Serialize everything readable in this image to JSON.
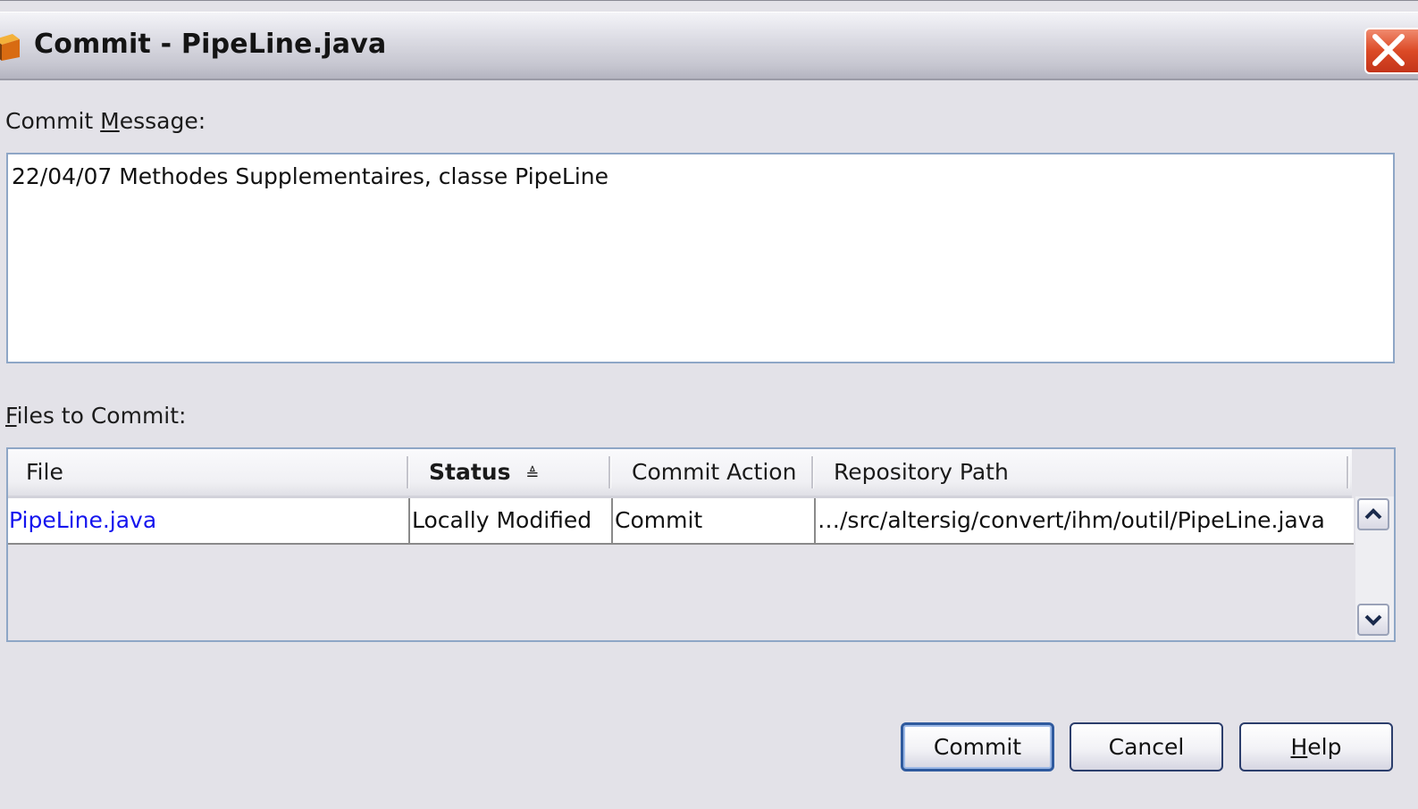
{
  "window": {
    "title": "Commit - PipeLine.java"
  },
  "message": {
    "label_prefix": "Commit ",
    "label_mnemonic": "M",
    "label_suffix": "essage:",
    "value": "22/04/07 Methodes Supplementaires, classe PipeLine"
  },
  "files": {
    "label_mnemonic": "F",
    "label_suffix": "iles to Commit:",
    "columns": [
      "File",
      "Status",
      "Commit Action",
      "Repository Path"
    ],
    "sort_indicator": "≜",
    "rows": [
      {
        "file": "PipeLine.java",
        "status": "Locally Modified",
        "action": "Commit",
        "path": "…/src/altersig/convert/ihm/outil/PipeLine.java"
      }
    ]
  },
  "buttons": {
    "commit": "Commit",
    "cancel": "Cancel",
    "help_mnemonic": "H",
    "help_suffix": "elp"
  },
  "colors": {
    "link": "#1515ee",
    "close": "#dc4a26",
    "border": "#8ea6c6"
  },
  "icons": {
    "app": "netbeans-cube-icon",
    "close": "close-x-icon",
    "scroll_up": "chevron-up-icon",
    "scroll_down": "chevron-down-icon"
  }
}
